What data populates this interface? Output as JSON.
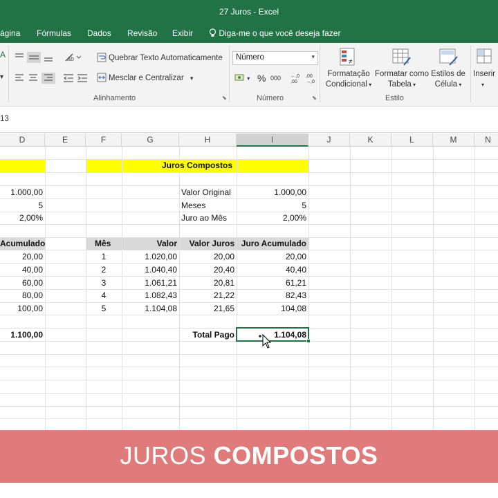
{
  "window": {
    "title": "27 Juros - Excel"
  },
  "tabs": [
    "ágina",
    "Fórmulas",
    "Dados",
    "Revisão",
    "Exibir"
  ],
  "tell_me": "Diga-me o que você deseja fazer",
  "ribbon": {
    "wrap_text": "Quebrar Texto Automaticamente",
    "merge_center": "Mesclar e Centralizar",
    "alignment_label": "Alinhamento",
    "number_format": "Número",
    "number_label": "Número",
    "percent_symbol": "%",
    "thousands_symbol": "000",
    "conditional_format": [
      "Formatação",
      "Condicional"
    ],
    "format_table": [
      "Formatar como",
      "Tabela"
    ],
    "cell_styles": [
      "Estilos de",
      "Célula"
    ],
    "style_label": "Estilo",
    "insert": "Inserir"
  },
  "namebox": "13",
  "columns": [
    "D",
    "E",
    "F",
    "G",
    "H",
    "I",
    "J",
    "K",
    "L",
    "M",
    "N"
  ],
  "left_block": {
    "values": [
      "1.000,00",
      "5",
      "2,00%"
    ],
    "header": "Acumulado",
    "rows": [
      "20,00",
      "40,00",
      "60,00",
      "80,00",
      "100,00"
    ],
    "total": "1.100,00"
  },
  "compound": {
    "title": "Juros Compostos",
    "params": [
      {
        "label": "Valor Original",
        "value": "1.000,00"
      },
      {
        "label": "Meses",
        "value": "5"
      },
      {
        "label": "Juro ao Mês",
        "value": "2,00%"
      }
    ],
    "headers": [
      "Mês",
      "Valor",
      "Valor Juros",
      "Juro Acumulado"
    ],
    "rows": [
      [
        "1",
        "1.020,00",
        "20,00",
        "20,00"
      ],
      [
        "2",
        "1.040,40",
        "20,40",
        "40,40"
      ],
      [
        "3",
        "1.061,21",
        "20,81",
        "61,21"
      ],
      [
        "4",
        "1.082,43",
        "21,22",
        "82,43"
      ],
      [
        "5",
        "1.104,08",
        "21,65",
        "104,08"
      ]
    ],
    "total_label": "Total Pago",
    "total_value": "1.104,08"
  },
  "banner": {
    "light": "JUROS",
    "bold": "COMPOSTOS"
  },
  "colors": {
    "excel_green": "#217346",
    "highlight_yellow": "#ffff00",
    "banner": "#e07b7b"
  }
}
